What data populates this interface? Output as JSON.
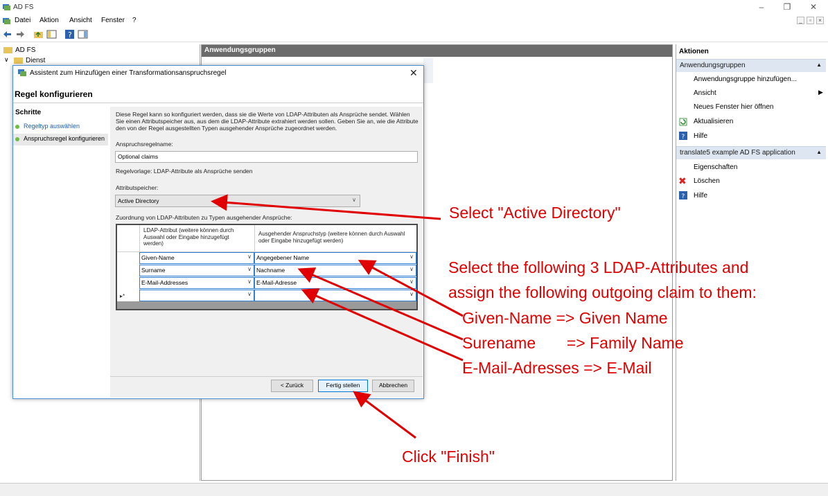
{
  "window": {
    "title": "AD FS"
  },
  "menu": {
    "items": [
      "Datei",
      "Aktion",
      "Ansicht",
      "Fenster",
      "?"
    ]
  },
  "tree": {
    "root": "AD FS",
    "child": "Dienst"
  },
  "center": {
    "header": "Anwendungsgruppen"
  },
  "actions": {
    "title": "Aktionen",
    "section1": {
      "label": "Anwendungsgruppen",
      "items": [
        "Anwendungsgruppe hinzufügen...",
        "Ansicht",
        "Neues Fenster hier öffnen",
        "Aktualisieren",
        "Hilfe"
      ]
    },
    "section2": {
      "label": "translate5 example AD FS application",
      "items": [
        "Eigenschaften",
        "Löschen",
        "Hilfe"
      ]
    }
  },
  "dialog": {
    "title": "Assistent zum Hinzufügen einer Transformationsanspruchsregel",
    "heading": "Regel konfigurieren",
    "steps_title": "Schritte",
    "steps": [
      "Regeltyp auswählen",
      "Anspruchsregel konfigurieren"
    ],
    "description": "Diese Regel kann so konfiguriert werden, dass sie die Werte von LDAP-Attributen als Ansprüche sendet. Wählen Sie einen Attributspeicher aus, aus dem die LDAP-Attribute extrahiert werden sollen. Geben Sie an, wie die Attribute den von der Regel ausgestellten Typen ausgehender Ansprüche zugeordnet werden.",
    "rule_name_label": "Anspruchsregelname:",
    "rule_name_value": "Optional claims",
    "template_text": "Regelvorlage: LDAP-Attribute als Ansprüche senden",
    "store_label": "Attributspeicher:",
    "store_value": "Active Directory",
    "mapping_label": "Zuordnung von LDAP-Attributen zu Typen ausgehender Ansprüche:",
    "grid_header_ldap": "LDAP-Attribut (weitere können durch Auswahl oder Eingabe hinzugefügt werden)",
    "grid_header_claim": "Ausgehender Anspruchstyp (weitere können durch Auswahl oder Eingabe hinzugefügt werden)",
    "rows": [
      {
        "ldap": "Given-Name",
        "claim": "Angegebener Name"
      },
      {
        "ldap": "Surname",
        "claim": "Nachname"
      },
      {
        "ldap": "E-Mail-Addresses",
        "claim": "E-Mail-Adresse"
      },
      {
        "ldap": "",
        "claim": ""
      }
    ],
    "new_row_marker": "▸*",
    "buttons": {
      "back": "< Zurück",
      "finish": "Fertig stellen",
      "cancel": "Abbrechen"
    }
  },
  "annotations": {
    "select_ad": "Select \"Active Directory\"",
    "select_attrs_1": "Select the following 3 LDAP-Attributes and",
    "select_attrs_2": "assign the following outgoing claim to them:",
    "map_given": "Given-Name  => Given Name",
    "map_surname": "Surename       => Family Name",
    "map_email": "E-Mail-Adresses => E-Mail",
    "click_finish": "Click \"Finish\""
  },
  "colors": {
    "annotation": "#e00000",
    "header_bar": "#6b6b6b",
    "action_section": "#dde6f1",
    "accent": "#0078d7"
  }
}
